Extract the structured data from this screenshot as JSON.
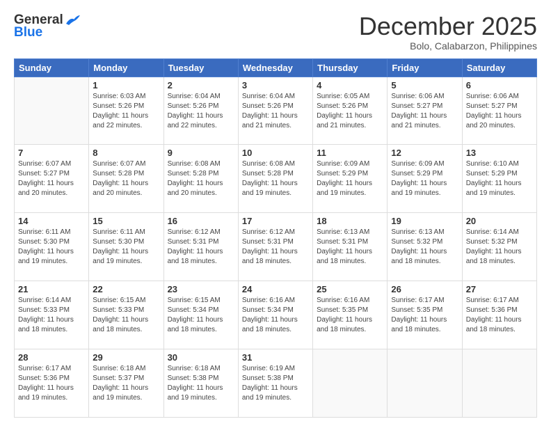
{
  "header": {
    "logo": {
      "line1": "General",
      "line2": "Blue"
    },
    "title": "December 2025",
    "location": "Bolo, Calabarzon, Philippines"
  },
  "weekdays": [
    "Sunday",
    "Monday",
    "Tuesday",
    "Wednesday",
    "Thursday",
    "Friday",
    "Saturday"
  ],
  "weeks": [
    [
      {
        "day": "",
        "info": ""
      },
      {
        "day": "1",
        "info": "Sunrise: 6:03 AM\nSunset: 5:26 PM\nDaylight: 11 hours\nand 22 minutes."
      },
      {
        "day": "2",
        "info": "Sunrise: 6:04 AM\nSunset: 5:26 PM\nDaylight: 11 hours\nand 22 minutes."
      },
      {
        "day": "3",
        "info": "Sunrise: 6:04 AM\nSunset: 5:26 PM\nDaylight: 11 hours\nand 21 minutes."
      },
      {
        "day": "4",
        "info": "Sunrise: 6:05 AM\nSunset: 5:26 PM\nDaylight: 11 hours\nand 21 minutes."
      },
      {
        "day": "5",
        "info": "Sunrise: 6:06 AM\nSunset: 5:27 PM\nDaylight: 11 hours\nand 21 minutes."
      },
      {
        "day": "6",
        "info": "Sunrise: 6:06 AM\nSunset: 5:27 PM\nDaylight: 11 hours\nand 20 minutes."
      }
    ],
    [
      {
        "day": "7",
        "info": "Sunrise: 6:07 AM\nSunset: 5:27 PM\nDaylight: 11 hours\nand 20 minutes."
      },
      {
        "day": "8",
        "info": "Sunrise: 6:07 AM\nSunset: 5:28 PM\nDaylight: 11 hours\nand 20 minutes."
      },
      {
        "day": "9",
        "info": "Sunrise: 6:08 AM\nSunset: 5:28 PM\nDaylight: 11 hours\nand 20 minutes."
      },
      {
        "day": "10",
        "info": "Sunrise: 6:08 AM\nSunset: 5:28 PM\nDaylight: 11 hours\nand 19 minutes."
      },
      {
        "day": "11",
        "info": "Sunrise: 6:09 AM\nSunset: 5:29 PM\nDaylight: 11 hours\nand 19 minutes."
      },
      {
        "day": "12",
        "info": "Sunrise: 6:09 AM\nSunset: 5:29 PM\nDaylight: 11 hours\nand 19 minutes."
      },
      {
        "day": "13",
        "info": "Sunrise: 6:10 AM\nSunset: 5:29 PM\nDaylight: 11 hours\nand 19 minutes."
      }
    ],
    [
      {
        "day": "14",
        "info": "Sunrise: 6:11 AM\nSunset: 5:30 PM\nDaylight: 11 hours\nand 19 minutes."
      },
      {
        "day": "15",
        "info": "Sunrise: 6:11 AM\nSunset: 5:30 PM\nDaylight: 11 hours\nand 19 minutes."
      },
      {
        "day": "16",
        "info": "Sunrise: 6:12 AM\nSunset: 5:31 PM\nDaylight: 11 hours\nand 18 minutes."
      },
      {
        "day": "17",
        "info": "Sunrise: 6:12 AM\nSunset: 5:31 PM\nDaylight: 11 hours\nand 18 minutes."
      },
      {
        "day": "18",
        "info": "Sunrise: 6:13 AM\nSunset: 5:31 PM\nDaylight: 11 hours\nand 18 minutes."
      },
      {
        "day": "19",
        "info": "Sunrise: 6:13 AM\nSunset: 5:32 PM\nDaylight: 11 hours\nand 18 minutes."
      },
      {
        "day": "20",
        "info": "Sunrise: 6:14 AM\nSunset: 5:32 PM\nDaylight: 11 hours\nand 18 minutes."
      }
    ],
    [
      {
        "day": "21",
        "info": "Sunrise: 6:14 AM\nSunset: 5:33 PM\nDaylight: 11 hours\nand 18 minutes."
      },
      {
        "day": "22",
        "info": "Sunrise: 6:15 AM\nSunset: 5:33 PM\nDaylight: 11 hours\nand 18 minutes."
      },
      {
        "day": "23",
        "info": "Sunrise: 6:15 AM\nSunset: 5:34 PM\nDaylight: 11 hours\nand 18 minutes."
      },
      {
        "day": "24",
        "info": "Sunrise: 6:16 AM\nSunset: 5:34 PM\nDaylight: 11 hours\nand 18 minutes."
      },
      {
        "day": "25",
        "info": "Sunrise: 6:16 AM\nSunset: 5:35 PM\nDaylight: 11 hours\nand 18 minutes."
      },
      {
        "day": "26",
        "info": "Sunrise: 6:17 AM\nSunset: 5:35 PM\nDaylight: 11 hours\nand 18 minutes."
      },
      {
        "day": "27",
        "info": "Sunrise: 6:17 AM\nSunset: 5:36 PM\nDaylight: 11 hours\nand 18 minutes."
      }
    ],
    [
      {
        "day": "28",
        "info": "Sunrise: 6:17 AM\nSunset: 5:36 PM\nDaylight: 11 hours\nand 19 minutes."
      },
      {
        "day": "29",
        "info": "Sunrise: 6:18 AM\nSunset: 5:37 PM\nDaylight: 11 hours\nand 19 minutes."
      },
      {
        "day": "30",
        "info": "Sunrise: 6:18 AM\nSunset: 5:38 PM\nDaylight: 11 hours\nand 19 minutes."
      },
      {
        "day": "31",
        "info": "Sunrise: 6:19 AM\nSunset: 5:38 PM\nDaylight: 11 hours\nand 19 minutes."
      },
      {
        "day": "",
        "info": ""
      },
      {
        "day": "",
        "info": ""
      },
      {
        "day": "",
        "info": ""
      }
    ]
  ]
}
